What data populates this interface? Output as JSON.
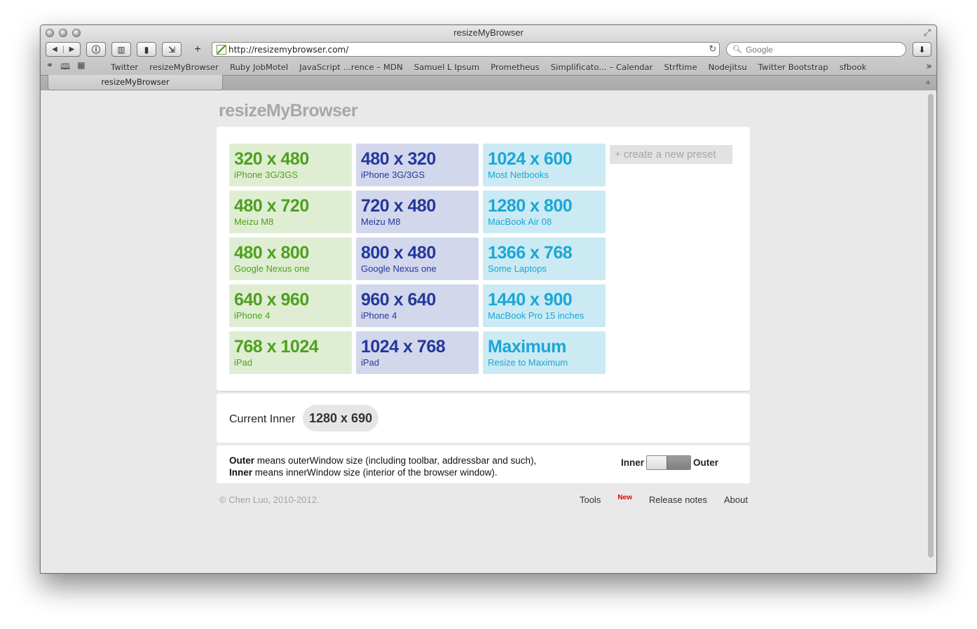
{
  "browser": {
    "window_title": "resizeMyBrowser",
    "url": "http://resizemybrowser.com/",
    "search_placeholder": "Google",
    "bookmarks": [
      "Twitter",
      "resizeMyBrowser",
      "Ruby JobMotel",
      "JavaScript ...rence – MDN",
      "Samuel L Ipsum",
      "Prometheus",
      "Simplificato... – Calendar",
      "Strftime",
      "Nodejitsu",
      "Twitter Bootstrap",
      "sfbook"
    ],
    "tab_title": "resizeMyBrowser"
  },
  "site": {
    "logo": "resizeMyBrowser",
    "presets": [
      {
        "size": "320 x 480",
        "desc": "iPhone 3G/3GS",
        "color": "green"
      },
      {
        "size": "480 x 320",
        "desc": "iPhone 3G/3GS",
        "color": "blue"
      },
      {
        "size": "1024 x 600",
        "desc": "Most Netbooks",
        "color": "cyan"
      },
      {
        "size": "480 x 720",
        "desc": "Meizu M8",
        "color": "green"
      },
      {
        "size": "720 x 480",
        "desc": "Meizu M8",
        "color": "blue"
      },
      {
        "size": "1280 x 800",
        "desc": "MacBook Air 08",
        "color": "cyan"
      },
      {
        "size": "480 x 800",
        "desc": "Google Nexus one",
        "color": "green"
      },
      {
        "size": "800 x 480",
        "desc": "Google Nexus one",
        "color": "blue"
      },
      {
        "size": "1366 x 768",
        "desc": "Some Laptops",
        "color": "cyan"
      },
      {
        "size": "640 x 960",
        "desc": "iPhone 4",
        "color": "green"
      },
      {
        "size": "960 x 640",
        "desc": "iPhone 4",
        "color": "blue"
      },
      {
        "size": "1440 x 900",
        "desc": "MacBook Pro 15 inches",
        "color": "cyan"
      },
      {
        "size": "768 x 1024",
        "desc": "iPad",
        "color": "green"
      },
      {
        "size": "1024 x 768",
        "desc": "iPad",
        "color": "blue"
      },
      {
        "size": "Maximum",
        "desc": "Resize to Maximum",
        "color": "cyan"
      }
    ],
    "new_preset_label": "+ create a new preset",
    "current_label": "Current Inner",
    "current_value": "1280 x 690",
    "mode": {
      "outer_term": "Outer",
      "outer_desc": " means outerWindow size (including toolbar, addressbar and such),",
      "inner_term": "Inner",
      "inner_desc": " means innerWindow size (interior of the browser window).",
      "toggle_left": "Inner",
      "toggle_right": "Outer",
      "toggle_state": "Outer"
    },
    "footer": {
      "copyright": "© Chen Luo, 2010-2012.",
      "tools": "Tools",
      "tools_badge": "New",
      "release_notes": "Release notes",
      "about": "About"
    }
  },
  "colors": {
    "green_bg": "#dfeed3",
    "green_fg": "#4fa01f",
    "blue_bg": "#d3d7ec",
    "blue_fg": "#23389c",
    "cyan_bg": "#cbeaf3",
    "cyan_fg": "#1aa7d6"
  }
}
